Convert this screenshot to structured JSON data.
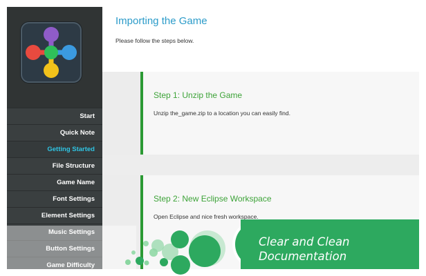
{
  "sidebar": {
    "logo": {
      "icon": "app-logo-icon",
      "colors": [
        "#8f5cc8",
        "#e84a3f",
        "#2fbf5a",
        "#3b9ae0",
        "#f2c21b"
      ]
    },
    "items": [
      {
        "label": "Start",
        "active": false
      },
      {
        "label": "Quick Note",
        "active": false
      },
      {
        "label": "Getting Started",
        "active": true
      },
      {
        "label": "File Structure",
        "active": false
      },
      {
        "label": "Game Name",
        "active": false
      },
      {
        "label": "Font Settings",
        "active": false
      },
      {
        "label": "Element Settings",
        "active": false
      },
      {
        "label": "Music Settings",
        "active": false
      },
      {
        "label": "Button Settings",
        "active": false
      },
      {
        "label": "Game Difficulty",
        "active": false
      }
    ]
  },
  "main": {
    "title": "Importing the Game",
    "subtitle": "Please follow the steps below.",
    "steps": [
      {
        "heading": "Step 1:  Unzip the Game",
        "text": "Unzip the_game.zip to a location you can easily find."
      },
      {
        "heading": "Step 2: New Eclipse Workspace",
        "text": "Open Eclipse and nice fresh workspace."
      }
    ]
  },
  "banner": {
    "line1": "Clear and Clean",
    "line2": "Documentation",
    "color": "#2da95f"
  },
  "colors": {
    "accent_title": "#2b9bc9",
    "active_nav": "#2fc4e3",
    "step_green": "#2c9a34"
  }
}
